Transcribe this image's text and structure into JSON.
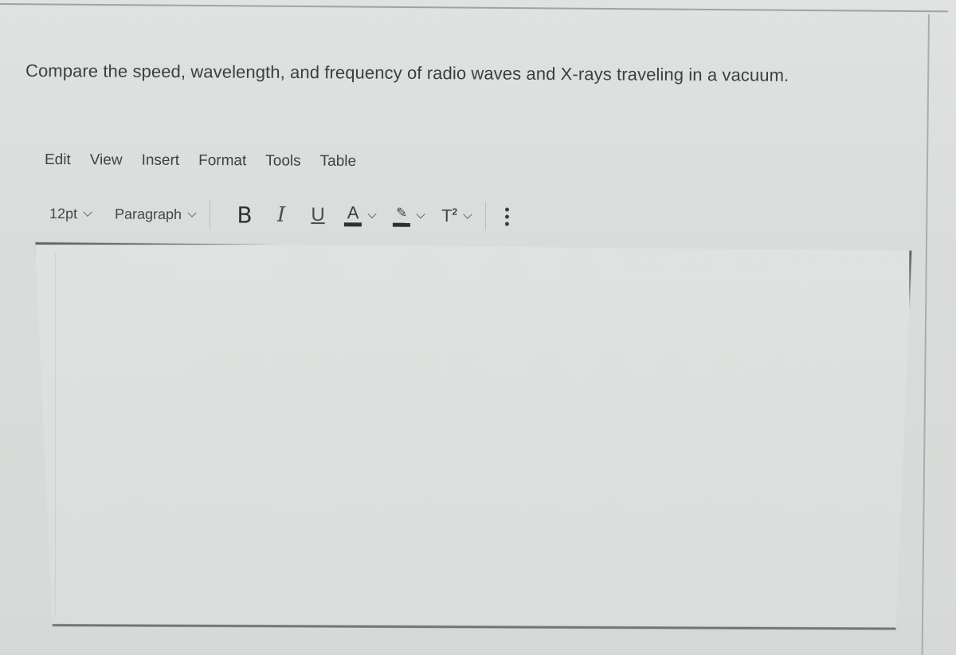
{
  "question": {
    "text": "Compare the speed, wavelength, and frequency of radio waves and X-rays traveling in a vacuum."
  },
  "menubar": {
    "items": [
      {
        "label": "Edit"
      },
      {
        "label": "View"
      },
      {
        "label": "Insert"
      },
      {
        "label": "Format"
      },
      {
        "label": "Tools"
      },
      {
        "label": "Table"
      }
    ]
  },
  "toolbar": {
    "font_size": "12pt",
    "block_format": "Paragraph",
    "bold_label": "B",
    "italic_label": "I",
    "underline_label": "U",
    "text_color_label": "A",
    "highlight_label": "✎",
    "superscript_label": "T",
    "superscript_mark": "2",
    "icons": {
      "font_size_chevron": "chevron-down-icon",
      "block_chevron": "chevron-down-icon",
      "text_color": "text-color-icon",
      "highlight": "highlighter-icon",
      "superscript": "superscript-icon",
      "more": "more-vertical-icon"
    }
  },
  "editor": {
    "content": ""
  }
}
